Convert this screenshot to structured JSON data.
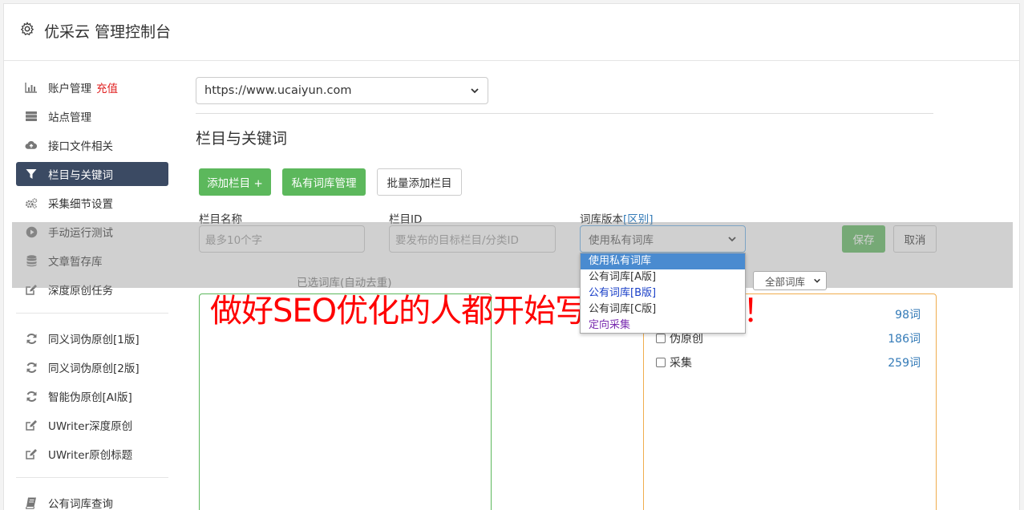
{
  "header": {
    "title": "优采云 管理控制台"
  },
  "sidebar": {
    "group1": [
      {
        "label": "账户管理",
        "extra": "充值",
        "icon": "bar-chart-icon"
      },
      {
        "label": "站点管理",
        "icon": "server-icon"
      },
      {
        "label": "接口文件相关",
        "icon": "cloud-upload-icon"
      },
      {
        "label": "栏目与关键词",
        "icon": "filter-icon",
        "active": true
      },
      {
        "label": "采集细节设置",
        "icon": "cogs-icon"
      },
      {
        "label": "手动运行测试",
        "icon": "play-circle-icon"
      },
      {
        "label": "文章暂存库",
        "icon": "database-icon"
      },
      {
        "label": "深度原创任务",
        "icon": "edit-icon"
      }
    ],
    "group2": [
      {
        "label": "同义词伪原创[1版]",
        "icon": "refresh-icon"
      },
      {
        "label": "同义词伪原创[2版]",
        "icon": "refresh-icon"
      },
      {
        "label": "智能伪原创[AI版]",
        "icon": "refresh-icon"
      },
      {
        "label": "UWriter深度原创",
        "icon": "edit-icon"
      },
      {
        "label": "UWriter原创标题",
        "icon": "edit-icon"
      }
    ],
    "group3": [
      {
        "label": "公有词库查询",
        "icon": "book-icon"
      }
    ]
  },
  "main": {
    "site_select": "https://www.ucaiyun.com",
    "section_title": "栏目与关键词",
    "buttons": {
      "add_column": "添加栏目 +",
      "private_lib": "私有词库管理",
      "batch_add": "批量添加栏目"
    },
    "form": {
      "name_label": "栏目名称",
      "name_placeholder": "最多10个字",
      "id_label": "栏目ID",
      "id_placeholder": "要发布的目标栏目/分类ID",
      "version_label": "词库版本",
      "version_link": "[区别]",
      "version_value": "使用私有词库",
      "save": "保存",
      "cancel": "取消"
    },
    "dropdown_options": [
      {
        "label": "使用私有词库",
        "selected": true
      },
      {
        "label": "公有词库[A版]"
      },
      {
        "label": "公有词库[B版]"
      },
      {
        "label": "公有词库[C版]"
      },
      {
        "label": "定向采集"
      }
    ],
    "selected_libs_label": "已选词库(自动去重)",
    "lib_filter": "全部词库",
    "libs": [
      {
        "name": "",
        "count": "98词"
      },
      {
        "name": "伪原创",
        "count": "186词"
      },
      {
        "name": "采集",
        "count": "259词"
      }
    ]
  },
  "banner": "做好SEO优化的人都开始写原创文章了！"
}
